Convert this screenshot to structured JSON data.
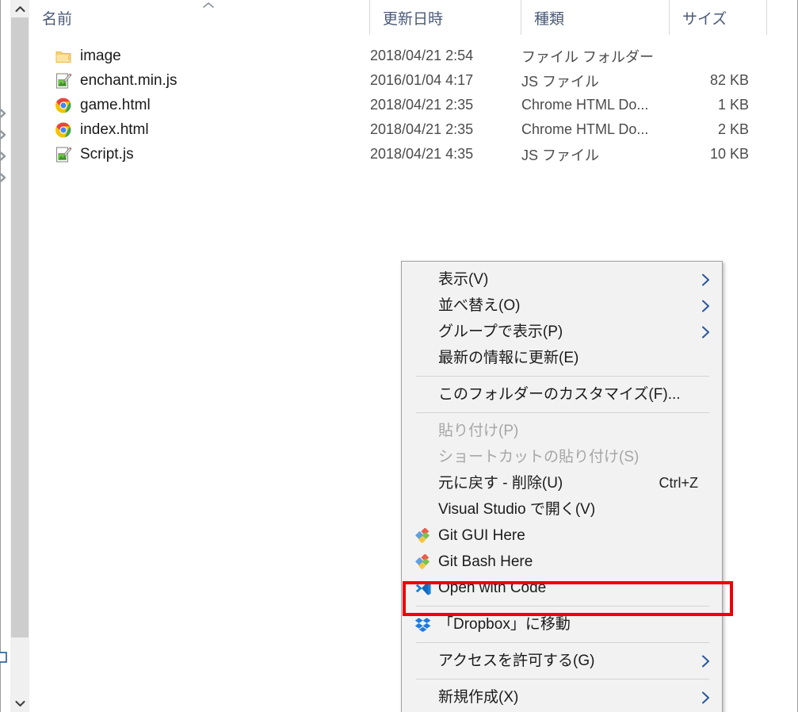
{
  "file_list": {
    "columns": [
      {
        "label": "名前",
        "icon": "sort-ascending-icon"
      },
      {
        "label": "更新日時"
      },
      {
        "label": "種類"
      },
      {
        "label": "サイズ"
      }
    ],
    "rows": [
      {
        "icon": "folder-icon",
        "name": "image",
        "date": "2018/04/21 2:54",
        "type": "ファイル フォルダー",
        "size": ""
      },
      {
        "icon": "js-file-icon",
        "name": "enchant.min.js",
        "date": "2016/01/04 4:17",
        "type": "JS ファイル",
        "size": "82 KB"
      },
      {
        "icon": "chrome-icon",
        "name": "game.html",
        "date": "2018/04/21 2:35",
        "type": "Chrome HTML Do...",
        "size": "1 KB"
      },
      {
        "icon": "chrome-icon",
        "name": "index.html",
        "date": "2018/04/21 2:35",
        "type": "Chrome HTML Do...",
        "size": "2 KB"
      },
      {
        "icon": "js-file-icon",
        "name": "Script.js",
        "date": "2018/04/21 4:35",
        "type": "JS ファイル",
        "size": "10 KB"
      }
    ]
  },
  "scrollbar": {
    "up_icon": "chevron-up-icon",
    "down_icon": "chevron-down-icon"
  },
  "nav_pane": {
    "expander_icon": "chevron-right-icon",
    "expander_count": 4
  },
  "context_menu": {
    "items": [
      {
        "label": "表示(V)",
        "icon": null,
        "accel": "",
        "arrow": true,
        "disabled": false,
        "highlighted": false
      },
      {
        "label": "並べ替え(O)",
        "icon": null,
        "accel": "",
        "arrow": true,
        "disabled": false,
        "highlighted": false
      },
      {
        "label": "グループで表示(P)",
        "icon": null,
        "accel": "",
        "arrow": true,
        "disabled": false,
        "highlighted": false
      },
      {
        "label": "最新の情報に更新(E)",
        "icon": null,
        "accel": "",
        "arrow": false,
        "disabled": false,
        "highlighted": false
      },
      {
        "separator": true
      },
      {
        "label": "このフォルダーのカスタマイズ(F)...",
        "icon": null,
        "accel": "",
        "arrow": false,
        "disabled": false,
        "highlighted": false
      },
      {
        "separator": true
      },
      {
        "label": "貼り付け(P)",
        "icon": null,
        "accel": "",
        "arrow": false,
        "disabled": true,
        "highlighted": false
      },
      {
        "label": "ショートカットの貼り付け(S)",
        "icon": null,
        "accel": "",
        "arrow": false,
        "disabled": true,
        "highlighted": false
      },
      {
        "label": "元に戻す - 削除(U)",
        "icon": null,
        "accel": "Ctrl+Z",
        "arrow": false,
        "disabled": false,
        "highlighted": false
      },
      {
        "label": "Visual Studio で開く(V)",
        "icon": null,
        "accel": "",
        "arrow": false,
        "disabled": false,
        "highlighted": false
      },
      {
        "label": "Git GUI Here",
        "icon": "git-icon",
        "accel": "",
        "arrow": false,
        "disabled": false,
        "highlighted": false
      },
      {
        "label": "Git Bash Here",
        "icon": "git-icon",
        "accel": "",
        "arrow": false,
        "disabled": false,
        "highlighted": false
      },
      {
        "label": "Open with Code",
        "icon": "vscode-icon",
        "accel": "",
        "arrow": false,
        "disabled": false,
        "highlighted": true
      },
      {
        "separator": true
      },
      {
        "label": "「Dropbox」に移動",
        "icon": "dropbox-icon",
        "accel": "",
        "arrow": false,
        "disabled": false,
        "highlighted": false
      },
      {
        "separator": true
      },
      {
        "label": "アクセスを許可する(G)",
        "icon": null,
        "accel": "",
        "arrow": true,
        "disabled": false,
        "highlighted": false
      },
      {
        "separator": true
      },
      {
        "label": "新規作成(X)",
        "icon": null,
        "accel": "",
        "arrow": true,
        "disabled": false,
        "highlighted": false
      }
    ]
  },
  "highlight": {
    "color": "#ef0000",
    "target_label": "Open with Code"
  },
  "colors": {
    "menu_background": "#f2f2f2",
    "menu_border": "#a0a0a0",
    "header_text": "#4a5a77",
    "disabled_text": "#a6a6a6",
    "submenu_arrow": "#2a5699",
    "scroll_thumb": "#cdcdcd",
    "highlight_red": "#ef0000"
  }
}
